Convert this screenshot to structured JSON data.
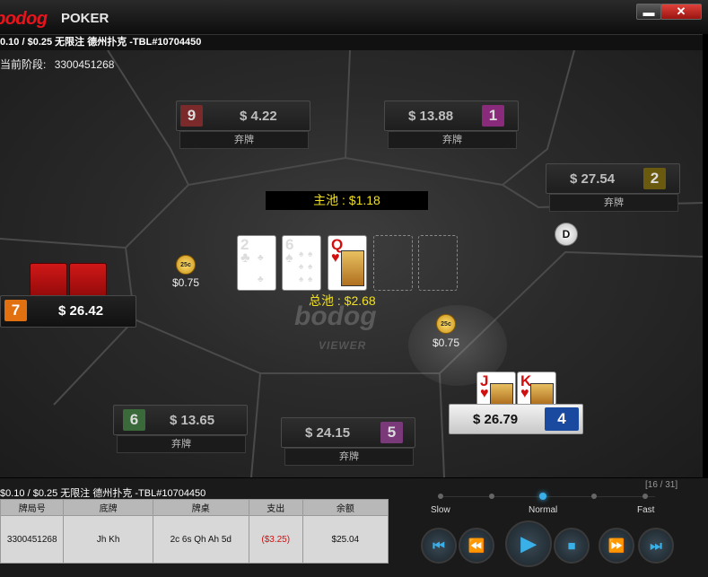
{
  "window": {
    "logo": "bodog",
    "logo_poker": "POKER",
    "minimize": "▬",
    "close": "✕"
  },
  "table_title": "0.10 / $0.25 无限注 德州扑克 -TBL#10704450",
  "stage": {
    "label": "当前阶段:",
    "value": "3300451268"
  },
  "seats": [
    {
      "num": "9",
      "amount": "$ 4.22",
      "status": "弃牌",
      "num_color": "#7a2a2a"
    },
    {
      "num": "1",
      "amount": "$ 13.88",
      "status": "弃牌",
      "num_color": "#8a2a7a"
    },
    {
      "num": "2",
      "amount": "$ 27.54",
      "status": "弃牌",
      "num_color": "#6a5a10"
    },
    {
      "num": "7",
      "amount": "$ 26.42",
      "status": "",
      "num_color": "#e07010"
    },
    {
      "num": "4",
      "amount": "$ 26.79",
      "status": "",
      "num_color": "#1a4aa0"
    },
    {
      "num": "6",
      "amount": "$ 13.65",
      "status": "弃牌",
      "num_color": "#3a6a3a"
    },
    {
      "num": "5",
      "amount": "$ 24.15",
      "status": "弃牌",
      "num_color": "#7a3a7a"
    }
  ],
  "pot": {
    "main": "主池 : $1.18",
    "total": "总池 : $2.68"
  },
  "board": [
    {
      "rank": "2",
      "suit": "♣",
      "color": "#000"
    },
    {
      "rank": "6",
      "suit": "♠",
      "color": "#000"
    },
    {
      "rank": "Q",
      "suit": "♥",
      "color": "#d01010"
    }
  ],
  "hero_cards": [
    {
      "rank": "J",
      "suit": "♥",
      "color": "#d01010"
    },
    {
      "rank": "K",
      "suit": "♥",
      "color": "#d01010"
    }
  ],
  "dealer_button": "D",
  "chips": [
    {
      "label": "25c",
      "amount": "$0.75"
    },
    {
      "label": "25c",
      "amount": "$0.75"
    }
  ],
  "center_logo": {
    "brand": "bodog",
    "sub": "VIEWER"
  },
  "hand_info": "$0.10 / $0.25 无限注 德州扑克 -TBL#10704450",
  "history": {
    "headers": [
      "牌局号",
      "底牌",
      "牌桌",
      "支出",
      "余额"
    ],
    "row": [
      "3300451268",
      "Jh Kh",
      "2c 6s Qh Ah 5d",
      "($3.25)",
      "$25.04"
    ]
  },
  "progress": "[16 / 31]",
  "speed": {
    "slow": "Slow",
    "normal": "Normal",
    "fast": "Fast"
  },
  "controls": {
    "first": "⏮",
    "rewind": "⏪",
    "play": "▶",
    "stop": "■",
    "forward": "⏩",
    "last": "⏭"
  },
  "colors": {
    "pot_text": "#f0e020",
    "accent": "#3ab0e8",
    "negative": "#d01010"
  }
}
